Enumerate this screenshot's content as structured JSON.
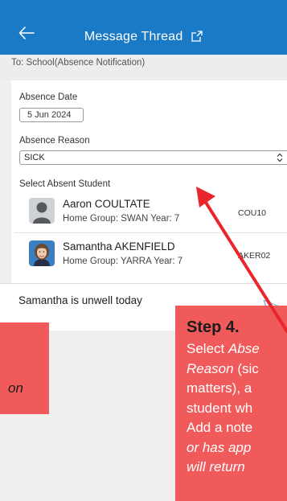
{
  "header": {
    "title": "Message Thread",
    "background": "#1a7ac6"
  },
  "to_line": "To: School(Absence Notification)",
  "absence_date": {
    "label": "Absence Date",
    "value": "5 Jun 2024"
  },
  "absence_reason": {
    "label": "Absence Reason",
    "selected": "SICK"
  },
  "students": {
    "label": "Select Absent Student",
    "items": [
      {
        "name": "Aaron COULTATE",
        "group": "Home Group: SWAN Year: 7",
        "code": "COU10"
      },
      {
        "name": "Samantha AKENFIELD",
        "group": "Home Group: YARRA Year: 7",
        "code": "AKER02"
      }
    ]
  },
  "note": {
    "text": "Samantha is unwell today"
  },
  "callouts": {
    "left_fragment": "on",
    "step_title": "Step 4.",
    "step_lines": [
      {
        "normal": "Select ",
        "italic": "Abse"
      },
      {
        "normal": "",
        "italic": "Reason",
        "after": " (sic"
      },
      {
        "normal": "matters), a",
        "italic": ""
      },
      {
        "normal": "student wh",
        "italic": ""
      },
      {
        "normal": "Add a note",
        "italic": ""
      },
      {
        "normal": "",
        "italic": "or has app"
      },
      {
        "normal": "",
        "italic": "will return"
      }
    ],
    "color": "#f05a5a",
    "arrow_color": "#e8262c"
  }
}
